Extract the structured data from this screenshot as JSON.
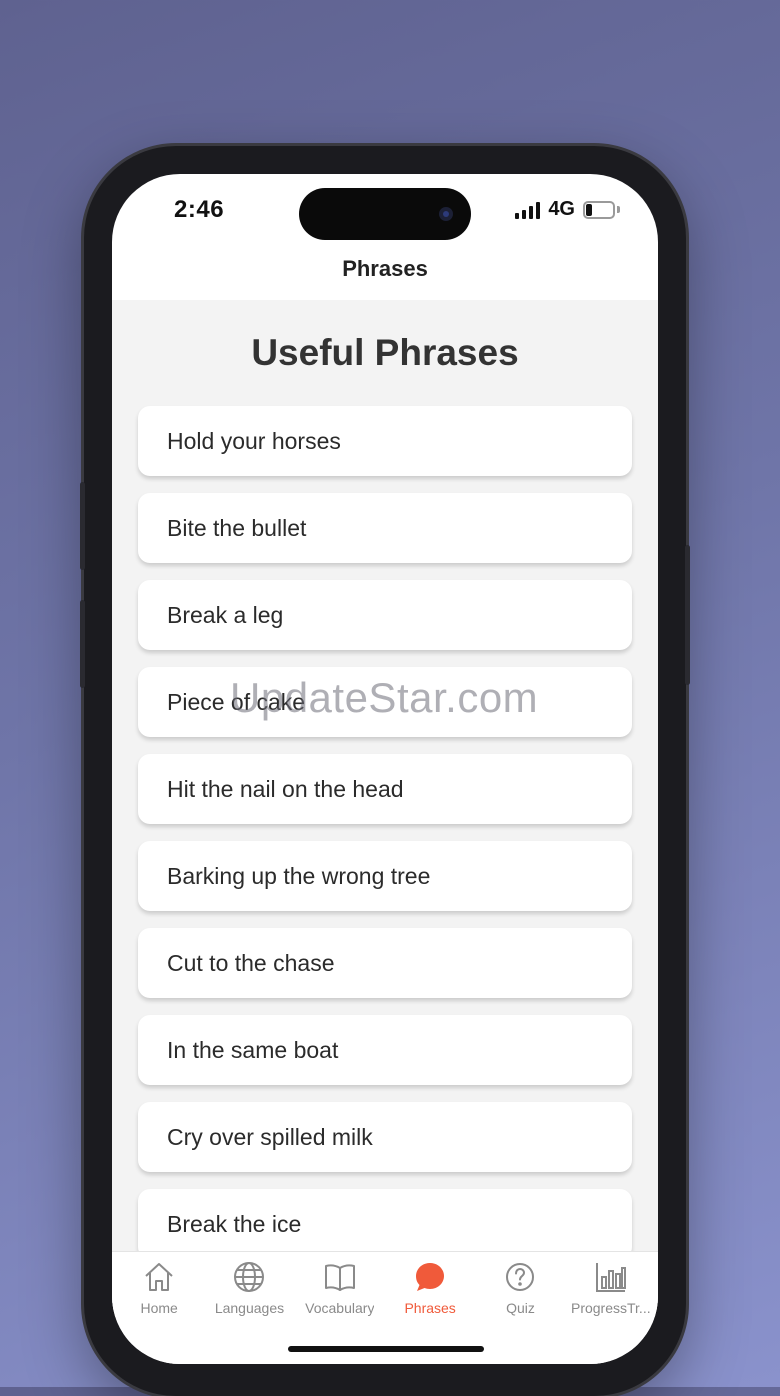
{
  "status_bar": {
    "time": "2:46",
    "network": "4G",
    "battery": "21"
  },
  "header": {
    "title": "Phrases"
  },
  "page": {
    "heading": "Useful Phrases"
  },
  "phrases": [
    "Hold your horses",
    "Bite the bullet",
    "Break a leg",
    "Piece of cake",
    "Hit the nail on the head",
    "Barking up the wrong tree",
    "Cut to the chase",
    "In the same boat",
    "Cry over spilled milk",
    "Break the ice"
  ],
  "watermark": "UpdateStar.com",
  "tabbar": {
    "tabs": [
      {
        "label": "Home",
        "icon": "home-icon",
        "active": false
      },
      {
        "label": "Languages",
        "icon": "globe-icon",
        "active": false
      },
      {
        "label": "Vocabulary",
        "icon": "book-icon",
        "active": false
      },
      {
        "label": "Phrases",
        "icon": "chat-bubble-icon",
        "active": true
      },
      {
        "label": "Quiz",
        "icon": "help-circle-icon",
        "active": false
      },
      {
        "label": "ProgressTr...",
        "icon": "bar-chart-icon",
        "active": false
      }
    ]
  },
  "colors": {
    "accent": "#f05a3a",
    "inactive": "#8a8a8a",
    "background": "#f3f3f3"
  }
}
